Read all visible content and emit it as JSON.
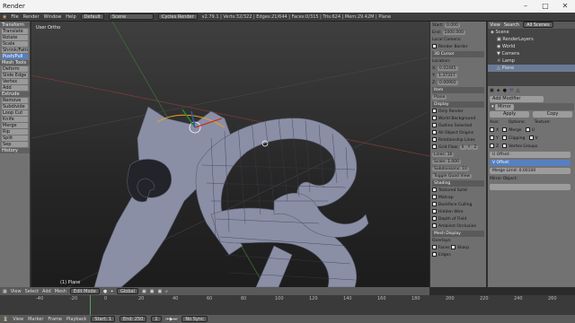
{
  "window": {
    "title": "Render"
  },
  "menu": {
    "file": "File",
    "render": "Render",
    "window": "Window",
    "help": "Help",
    "layout": "Default",
    "scene": "Scene",
    "engine": "Cycles Render",
    "stats": "v2.79.1 | Verts:32/322 | Edges:21/644 | Faces:0/315 | Tris:624 | Mem:29.42M | Plane"
  },
  "left": {
    "sections": [
      "Transform",
      "Translate",
      "Rotate",
      "Scale",
      "Shrink/Fatten",
      "Push/Pull",
      "Mesh Tools",
      "Deform",
      "Slide Edge",
      "Vertex",
      "Add",
      "Extrude",
      "Remove",
      "Subdivide",
      "Loop Cut",
      "Knife",
      "Merge",
      "Rip",
      "Split",
      "Sep"
    ],
    "history": "History",
    "mode": "Edit Mode"
  },
  "viewport": {
    "label": "User Ortho",
    "object": "(1) Plane"
  },
  "npanel": {
    "start": "Start:",
    "start_val": "0.000",
    "end": "End:",
    "end_val": "1000.000",
    "local_camera": "Local Camera:",
    "render_border": "Render Border",
    "cursor_label": "3D Cursor",
    "location": "Location:",
    "x_label": "X:",
    "x_val": "0.02445",
    "y_label": "Y:",
    "y_val": "1.37317",
    "z_label": "Z:",
    "z_val": "0.00902",
    "item_label": "Item",
    "item_name": "Plane",
    "display": "Display",
    "only_render": "Only Render",
    "world_bg": "World Background",
    "outline_sel": "Outline Selected",
    "all_edges": "All Object Origins",
    "rel_lines": "Relationship Lines",
    "grid_floor": "Grid Floor",
    "x": "X",
    "y": "Y",
    "z": "Z",
    "lines_label": "Lines:",
    "lines_val": "16",
    "scale_label": "Scale:",
    "scale_val": "1.000",
    "subdiv_label": "Subdivisions:",
    "subdiv_val": "10",
    "toggle_quad": "Toggle Quad View",
    "shading": "Shading",
    "textured_solid": "Textured Solid",
    "matcap": "Matcap",
    "backface_culling": "Backface Culling",
    "hidden_wire": "Hidden Wire",
    "depth_field": "Depth of Field",
    "ambient_occl": "Ambient Occlusion",
    "mesh_display": "Mesh Display",
    "overlays": "Overlays:",
    "faces": "Faces",
    "edges": "Edges",
    "sharp": "Sharp"
  },
  "outliner": {
    "view": "View",
    "search": "Search",
    "all_scenes": "All Scenes",
    "rows": [
      "Scene",
      "RenderLayers",
      "World",
      "Camera",
      "Lamp",
      "Plane"
    ]
  },
  "props": {
    "add_modifier": "Add Modifier",
    "mirror": "Mirror",
    "apply": "Apply",
    "copy": "Copy",
    "axis": "Axis:",
    "options": "Options:",
    "texture": "Texture:",
    "x": "X",
    "y": "Y",
    "z": "Z",
    "merge": "Merge",
    "clipping": "Clipping",
    "vertex_groups": "Vertex Groups",
    "u": "U",
    "v": "V",
    "u_offset": "U Offset:",
    "v_offset": "V Offset:",
    "merge_limit": "Merge Limit:",
    "merge_limit_val": "0.00100",
    "mirror_object": "Mirror Object:"
  },
  "toolbar": {
    "view": "View",
    "select": "Select",
    "add": "Add",
    "mesh": "Mesh",
    "mode": "Edit Mode",
    "global": "Global"
  },
  "timeline": {
    "view": "View",
    "marker": "Marker",
    "frame": "Frame",
    "playback": "Playback",
    "start": "Start:",
    "start_val": "1",
    "end": "End:",
    "end_val": "250",
    "current": "1",
    "nosync": "No Sync",
    "ticks": [
      "-40",
      "-20",
      "0",
      "20",
      "40",
      "60",
      "80",
      "100",
      "120",
      "140",
      "160",
      "180",
      "200",
      "220",
      "240",
      "260"
    ]
  }
}
